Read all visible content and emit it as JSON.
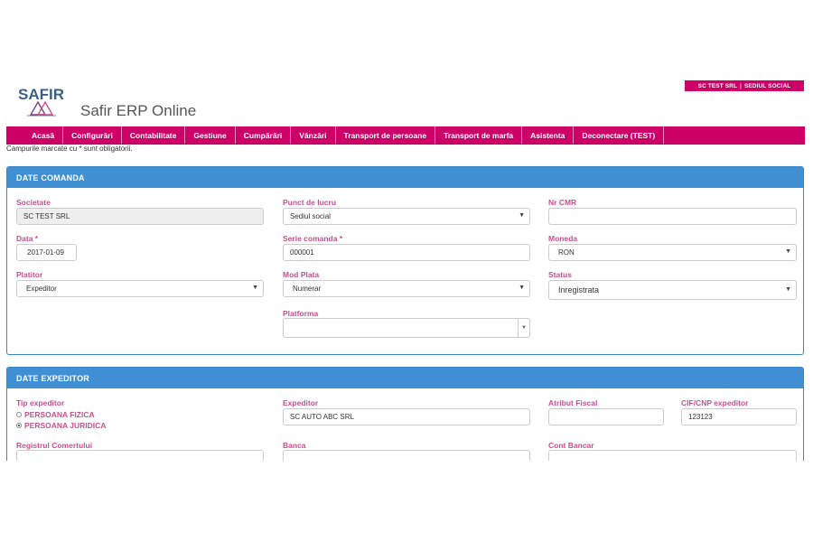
{
  "header": {
    "company": "SC TEST SRL",
    "location": "SEDIUL SOCIAL",
    "logo_text": "SAFIR",
    "app_title": "Safir ERP Online"
  },
  "nav": {
    "items": [
      "Acasă",
      "Configurări",
      "Contabilitate",
      "Gestiune",
      "Cumpărări",
      "Vânzări",
      "Transport de persoane",
      "Transport de marfa",
      "Asistenta",
      "Deconectare (TEST)"
    ]
  },
  "required_note": "Campurile marcate cu * sunt obligatorii.",
  "comanda": {
    "title": "DATE COMANDA",
    "societate": {
      "label": "Societate",
      "value": "SC TEST SRL"
    },
    "punct_lucru": {
      "label": "Punct de lucru",
      "value": "Sediul social"
    },
    "nr_cmr": {
      "label": "Nr CMR",
      "value": ""
    },
    "data": {
      "label": "Data *",
      "value": "2017-01-09"
    },
    "serie": {
      "label": "Serie comanda *",
      "value": "000001"
    },
    "moneda": {
      "label": "Moneda",
      "value": "RON"
    },
    "platitor": {
      "label": "Platitor",
      "value": "Expeditor"
    },
    "mod_plata": {
      "label": "Mod Plata",
      "value": "Numerar"
    },
    "status": {
      "label": "Status",
      "value": "Inregistrata"
    },
    "platforma": {
      "label": "Platforma",
      "value": ""
    }
  },
  "expeditor": {
    "title": "DATE EXPEDITOR",
    "tip": {
      "label": "Tip expeditor",
      "options": [
        "PERSOANA FIZICA",
        "PERSOANA JURIDICA"
      ],
      "selected": "PERSOANA JURIDICA"
    },
    "expeditor": {
      "label": "Expeditor",
      "value": "SC AUTO ABC SRL"
    },
    "atribut": {
      "label": "Atribut Fiscal",
      "value": ""
    },
    "cif": {
      "label": "CIF/CNP expeditor",
      "value": "123123"
    },
    "registrul": {
      "label": "Registrul Comertului",
      "value": ""
    },
    "banca": {
      "label": "Banca",
      "value": ""
    },
    "cont": {
      "label": "Cont Bancar",
      "value": ""
    }
  },
  "colors": {
    "brand": "#cc0066",
    "panel_header": "#3f8fd2",
    "label": "#c8508e"
  }
}
